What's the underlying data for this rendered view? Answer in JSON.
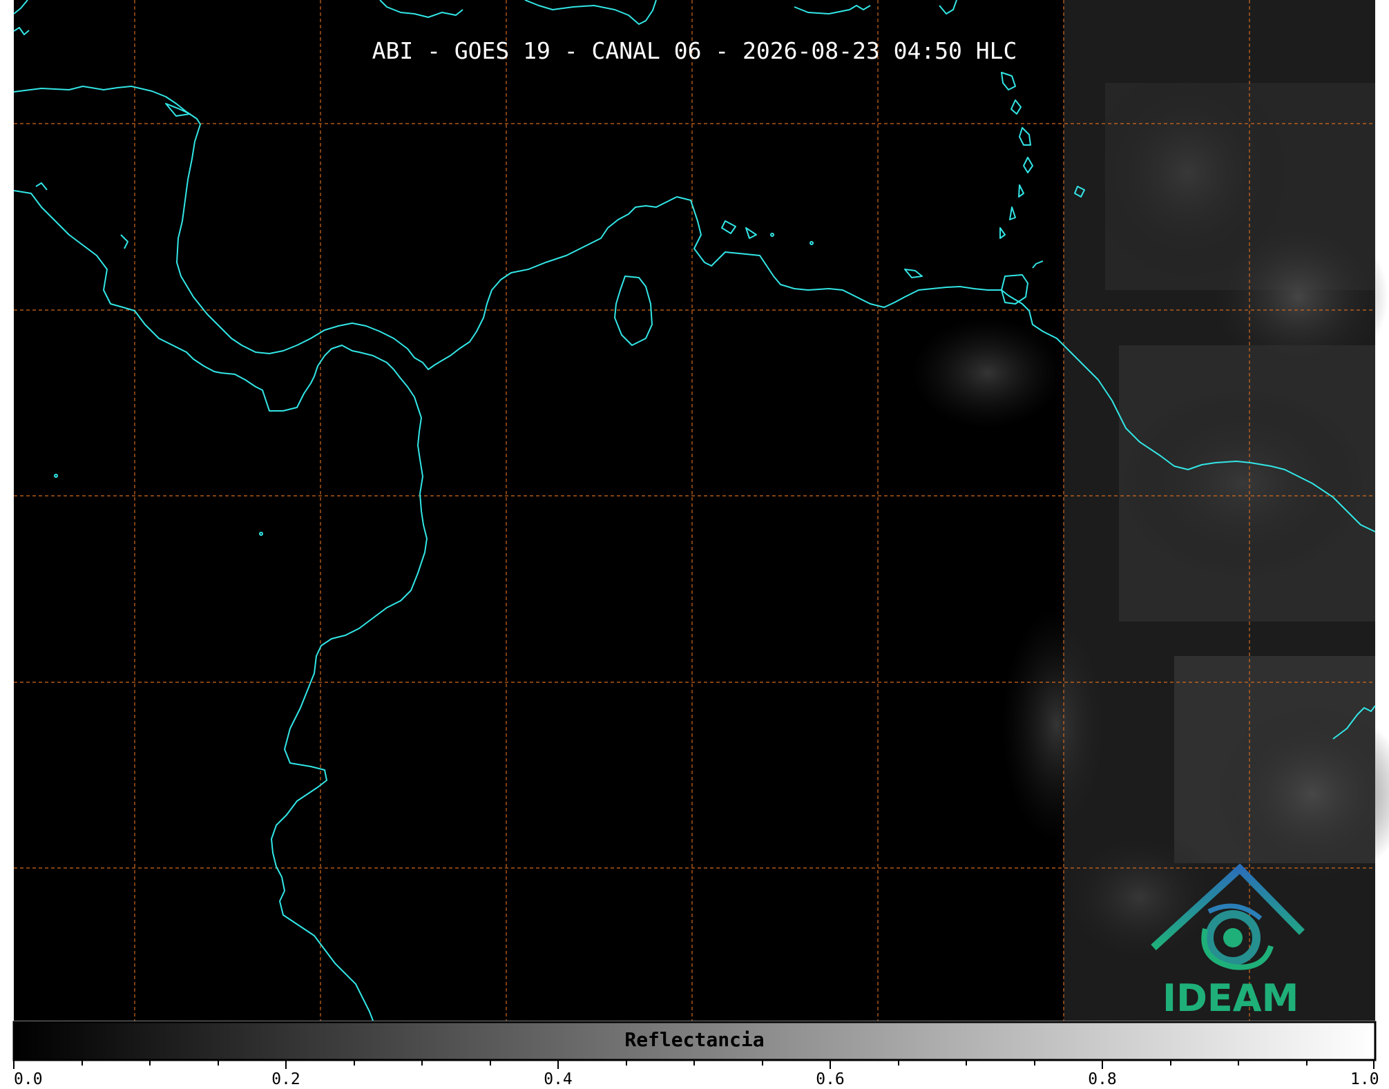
{
  "title": "ABI - GOES 19 - CANAL 06 - 2026-08-23 04:50 HLC",
  "colorbar": {
    "label": "Reflectancia",
    "ticks": [
      "0.0",
      "0.2",
      "0.4",
      "0.6",
      "0.8",
      "1.0"
    ],
    "range": [
      0.0,
      1.0
    ],
    "colormap": "grayscale"
  },
  "logo": {
    "text": "IDEAM"
  },
  "colors": {
    "background": "#000000",
    "coastline": "#33e6e6",
    "gridlines": "#d2691e",
    "logo_green": "#1fb07a",
    "logo_blue": "#2b7fb8"
  },
  "icons": {
    "logo": "ideam-logo-icon"
  }
}
